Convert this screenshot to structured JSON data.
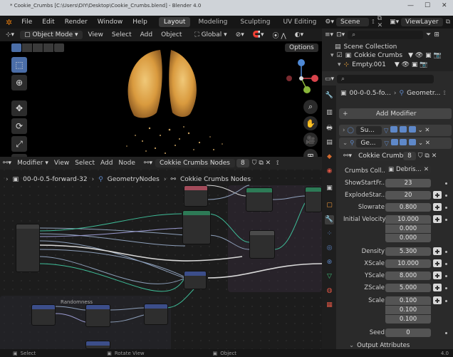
{
  "window": {
    "title": "* Cookie_Crumbs [C:\\Users\\DIY\\Desktop\\Cookie_Crumbs.blend] - Blender 4.0",
    "min": "—",
    "max": "☐",
    "close": "✕"
  },
  "menubar": {
    "items": [
      "File",
      "Edit",
      "Render",
      "Window",
      "Help"
    ],
    "tabs": [
      "Layout",
      "Modeling",
      "Sculpting",
      "UV Editing"
    ],
    "active_tab": "Layout",
    "scene": "Scene",
    "view_layer": "ViewLayer"
  },
  "viewport": {
    "mode": "Object Mode",
    "menus": [
      "View",
      "Select",
      "Add",
      "Object"
    ],
    "transform": "Global",
    "options": "Options"
  },
  "outliner": {
    "search_placeholder": "",
    "collection": "Scene Collection",
    "item1": "Cokkie Crumbs",
    "item2": "Empty.001"
  },
  "properties": {
    "search_placeholder": "",
    "object_breadcrumb": "00-0-0.5-fo...",
    "geometry_breadcrumb": "Geometr...",
    "add_modifier": "Add Modifier",
    "modifier1": "Su...",
    "modifier2": "Ge...",
    "node_group": "Cokkie Crumbs...",
    "users": "8",
    "collection_label": "Crumbs Coll...",
    "collection_value": "Debris...",
    "rows": [
      {
        "label": "ShowStartFr...",
        "value": "23"
      },
      {
        "label": "ExplodeStar...",
        "value": "20"
      },
      {
        "label": "Slowrate",
        "value": "0.800"
      },
      {
        "label": "Initial Velocity",
        "value": "10.000"
      },
      {
        "label": "",
        "value": "0.000"
      },
      {
        "label": "",
        "value": "0.000"
      },
      {
        "label": "Density",
        "value": "5.300"
      },
      {
        "label": "XScale",
        "value": "10.000"
      },
      {
        "label": "YScale",
        "value": "8.000"
      },
      {
        "label": "ZScale",
        "value": "5.000"
      },
      {
        "label": "Scale",
        "value": "0.100"
      },
      {
        "label": "",
        "value": "0.100"
      },
      {
        "label": "",
        "value": "0.100"
      },
      {
        "label": "Seed",
        "value": "0"
      }
    ],
    "output_attrs": "Output Attributes"
  },
  "node_editor": {
    "editor": "Modifier",
    "menus": [
      "View",
      "Select",
      "Add",
      "Node"
    ],
    "node_group": "Cokkie Crumbs Nodes",
    "users": "8",
    "breadcrumb": [
      "00-0-0.5-forward-32",
      "GeometryNodes",
      "Cokkie Crumbs Nodes"
    ],
    "frame_label": "Randomness"
  },
  "statusbar": {
    "select": "Select",
    "rotate": "Rotate View",
    "object": "Object",
    "version": "4.0"
  }
}
